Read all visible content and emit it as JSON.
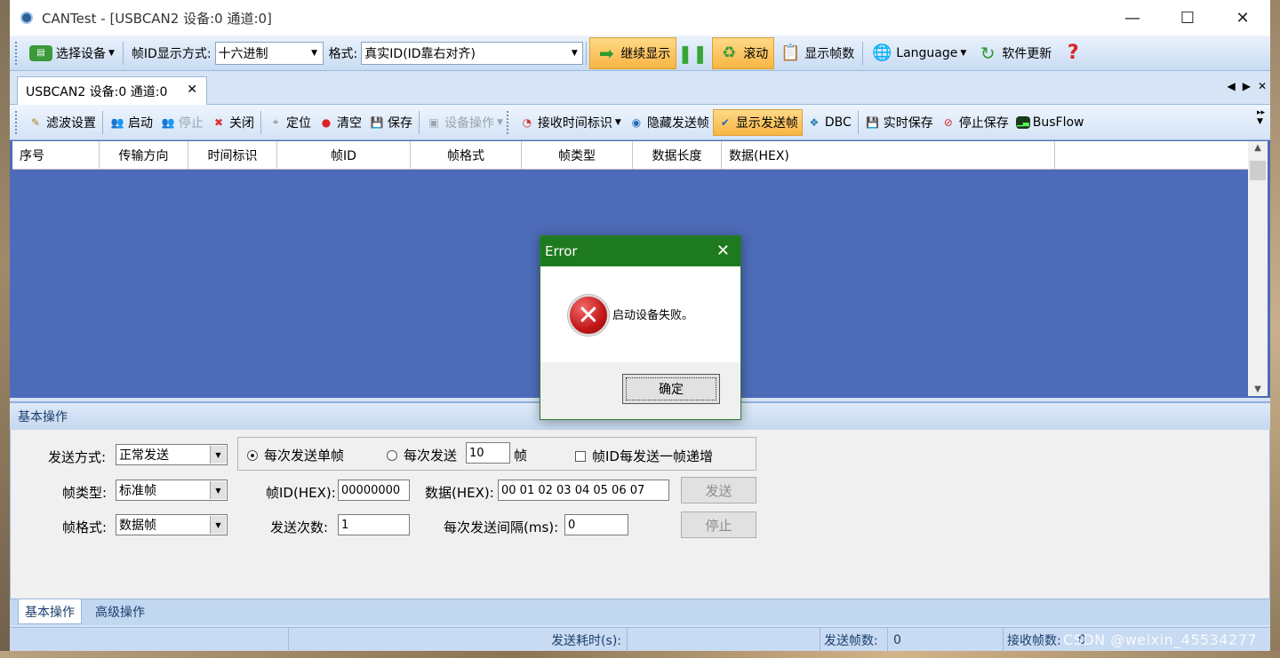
{
  "window": {
    "title": "CANTest  - [USBCAN2 设备:0 通道:0]",
    "controls": {
      "minimize": "—",
      "maximize": "☐",
      "close": "✕"
    }
  },
  "main_toolbar": {
    "select_device": "选择设备",
    "frame_id_display_label": "帧ID显示方式:",
    "frame_id_display_value": "十六进制",
    "format_label": "格式:",
    "format_value": "真实ID(ID靠右对齐)",
    "continue_display": "继续显示",
    "scroll": "滚动",
    "show_frame_count": "显示帧数",
    "language": "Language",
    "software_update": "软件更新"
  },
  "doc_tab": {
    "label": "USBCAN2 设备:0 通道:0"
  },
  "sub_toolbar": {
    "filter_settings": "滤波设置",
    "start": "启动",
    "stop": "停止",
    "close": "关闭",
    "locate": "定位",
    "clear": "清空",
    "save": "保存",
    "device_ops": "设备操作",
    "receive_timestamp": "接收时间标识",
    "hide_sent_frames": "隐藏发送帧",
    "show_sent_frames": "显示发送帧",
    "dbc": "DBC",
    "realtime_save": "实时保存",
    "stop_save": "停止保存",
    "busflow": "BusFlow"
  },
  "grid": {
    "columns": [
      "序号",
      "传输方向",
      "时间标识",
      "帧ID",
      "帧格式",
      "帧类型",
      "数据长度",
      "数据(HEX)"
    ]
  },
  "basic_panel": {
    "header": "基本操作",
    "send_mode_label": "发送方式:",
    "send_mode_value": "正常发送",
    "frame_type_label": "帧类型:",
    "frame_type_value": "标准帧",
    "frame_format_label": "帧格式:",
    "frame_format_value": "数据帧",
    "radio_single": "每次发送单帧",
    "radio_multi": "每次发送",
    "multi_count": "10",
    "frame_unit": "帧",
    "checkbox_increment": "帧ID每发送一帧递增",
    "frame_id_label": "帧ID(HEX):",
    "frame_id_value": "00000000",
    "data_label": "数据(HEX):",
    "data_value": "00 01 02 03 04 05 06 07",
    "send_button": "发送",
    "send_count_label": "发送次数:",
    "send_count_value": "1",
    "interval_label": "每次发送间隔(ms):",
    "interval_value": "0",
    "stop_button": "停止"
  },
  "bottom_tabs": [
    "基本操作",
    "高级操作"
  ],
  "status_bar": {
    "send_time_label": "发送耗时(s):",
    "sent_frames_label": "发送帧数:",
    "sent_frames_value": "0",
    "recv_frames_label": "接收帧数:",
    "recv_frames_value": "0"
  },
  "watermark": "CSDN @weixin_45534277",
  "dialog": {
    "title": "Error",
    "message": "启动设备失败。",
    "ok_button": "确定"
  },
  "colors": {
    "grid_background": "#4d6bb8",
    "dialog_title_bar": "#1e7a1e",
    "highlight_button": "#f7b543"
  }
}
